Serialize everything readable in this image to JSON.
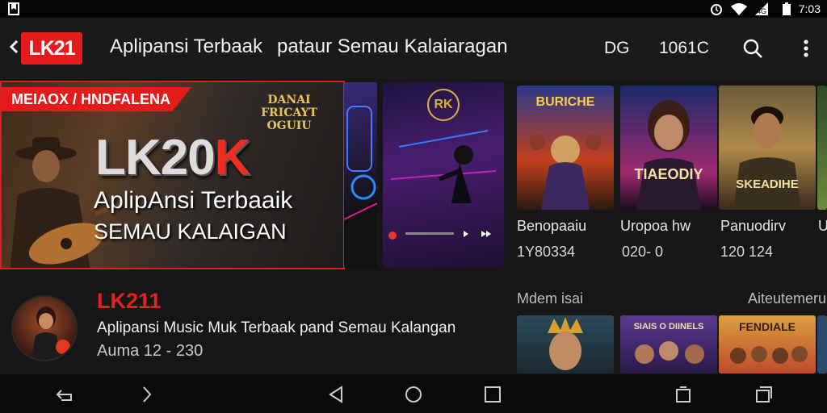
{
  "status_bar": {
    "time": "7:03",
    "icons": [
      "bookmark-icon",
      "alarm-icon",
      "wifi-icon",
      "signal-icon",
      "battery-icon"
    ]
  },
  "app_bar": {
    "logo": "LK21",
    "title_part1": "Aplipansi Terbaak",
    "title_part2": "pataur Semau Kalaiaragan",
    "item_1": "DG",
    "item_2": "1061C",
    "icons": [
      "back-arrow-icon",
      "search-icon",
      "more-vert-icon"
    ]
  },
  "hero": {
    "tag": "MEIAOX / HNDFALENA",
    "script_text_1": "DANAI",
    "script_text_2": "FRICAYT OGUIU",
    "big_title_main": "LK20",
    "big_title_accent": "K",
    "subtitle_1": "AplipAnsi Terbaaik",
    "subtitle_2": "SEMAU KALAIGAN"
  },
  "cards": [
    {
      "poster_text": "BURICHE",
      "title": "Benopaaiu",
      "number": "1Y80334",
      "accent": "#e8502a"
    },
    {
      "poster_text": "TIAEODIY",
      "title": "Uropoa hw",
      "number": "020- 0",
      "accent": "#d94a8a"
    },
    {
      "poster_text": "SKEADIHE",
      "title": "Panuodirv",
      "number": "120 124",
      "accent": "#c9a04a"
    },
    {
      "title": "U"
    }
  ],
  "channel": {
    "name": "LK211",
    "description": "Aplipansi Music Muk Terbaak pand Semau Kalangan",
    "meta": "Auma 12 - 230"
  },
  "section": {
    "left_label": "Mdem isai",
    "right_label": "Aiteutemeru",
    "thumbs": [
      {
        "text": "",
        "accent": "#3a3a3a"
      },
      {
        "text": "SIAIS O DIINELS",
        "accent": "#7a4fb0"
      },
      {
        "text": "FENDIALE",
        "accent": "#d9663a"
      }
    ]
  },
  "nav_bar": {
    "icons": [
      "nav-back-icon",
      "nav-forward-icon",
      "nav-triangle-back-icon",
      "nav-home-icon",
      "nav-recents-icon",
      "nav-rotate-icon",
      "nav-window-icon"
    ]
  }
}
